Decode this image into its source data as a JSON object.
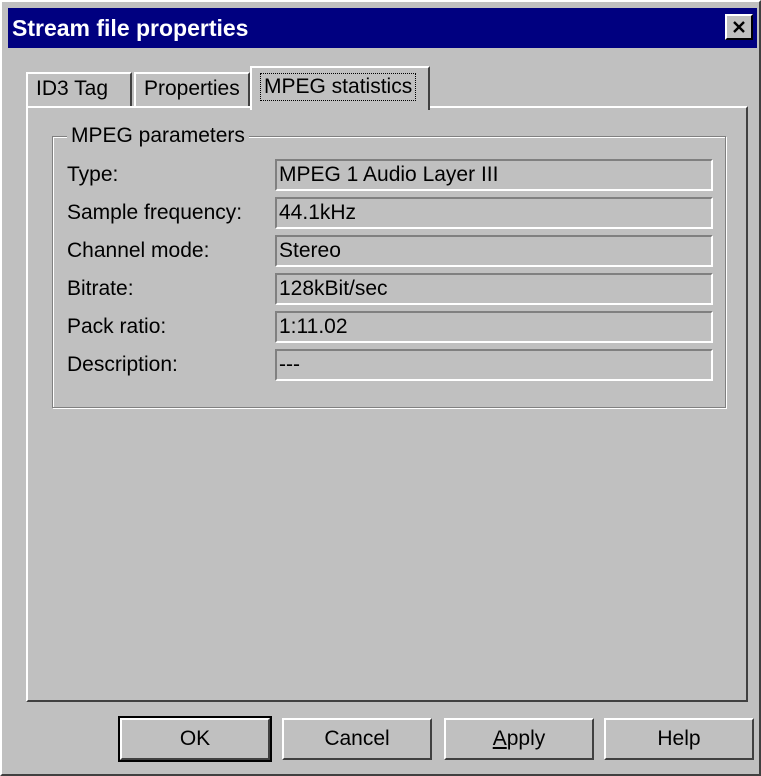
{
  "window": {
    "title": "Stream file properties"
  },
  "tabs": [
    {
      "label": "ID3 Tag",
      "active": false
    },
    {
      "label": "Properties",
      "active": false
    },
    {
      "label": "MPEG statistics",
      "active": true
    }
  ],
  "group": {
    "title": "MPEG parameters",
    "rows": [
      {
        "label": "Type:",
        "value": "MPEG 1 Audio Layer III"
      },
      {
        "label": "Sample frequency:",
        "value": "44.1kHz"
      },
      {
        "label": "Channel mode:",
        "value": "Stereo"
      },
      {
        "label": "Bitrate:",
        "value": "128kBit/sec"
      },
      {
        "label": "Pack ratio:",
        "value": "1:11.02"
      },
      {
        "label": "Description:",
        "value": "---"
      }
    ]
  },
  "buttons": {
    "ok": "OK",
    "cancel": "Cancel",
    "apply_prefix": "",
    "apply_mnemonic": "A",
    "apply_rest": "pply",
    "help": "Help"
  },
  "icons": {
    "close": "close-icon"
  },
  "colors": {
    "titlebar": "#000080",
    "face": "#c0c0c0"
  }
}
